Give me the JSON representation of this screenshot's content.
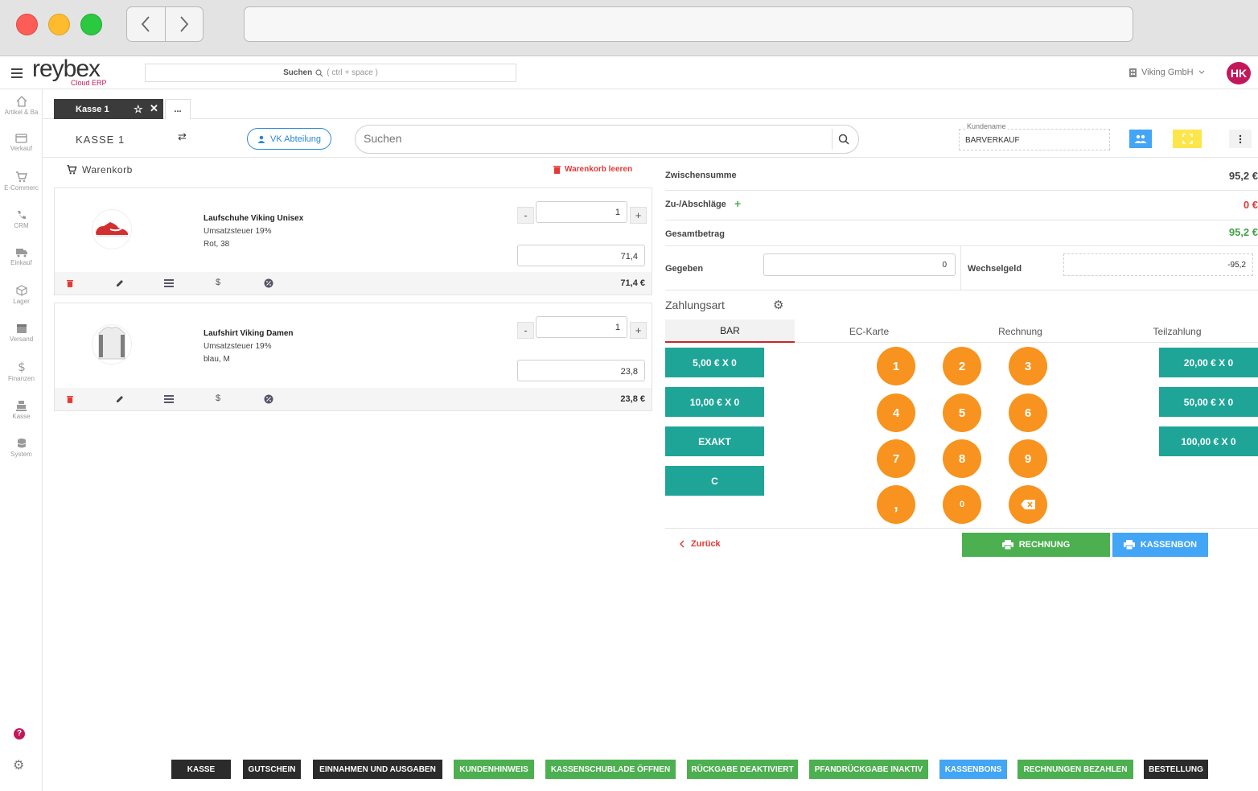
{
  "browser": {
    "url": ""
  },
  "app": {
    "logo_text": "reybex",
    "logo_sub": "Cloud ERP",
    "search_label": "Suchen",
    "search_hint": "( ctrl + space )",
    "company": "Viking GmbH",
    "avatar": "HK"
  },
  "sidebar": [
    {
      "label": "Artikel & Ba",
      "icon": "home-icon"
    },
    {
      "label": "Verkauf",
      "icon": "card-icon"
    },
    {
      "label": "E-Commerc",
      "icon": "cart-icon"
    },
    {
      "label": "CRM",
      "icon": "phone-icon"
    },
    {
      "label": "Einkauf",
      "icon": "truck-icon"
    },
    {
      "label": "Lager",
      "icon": "box-icon"
    },
    {
      "label": "Versand",
      "icon": "package-icon"
    },
    {
      "label": "Finanzen",
      "icon": "dollar-icon"
    },
    {
      "label": "Kasse",
      "icon": "register-icon"
    },
    {
      "label": "System",
      "icon": "database-icon"
    }
  ],
  "tabs": {
    "active": "Kasse 1",
    "more": "..."
  },
  "header": {
    "title": "KASSE 1",
    "department": "VK Abteilung",
    "search_placeholder": "Suchen",
    "kunde_label": "Kundename",
    "kunde_value": "BARVERKAUF"
  },
  "cart": {
    "title": "Warenkorb",
    "clear_label": "Warenkorb leeren",
    "items": [
      {
        "name": "Laufschuhe Viking Unisex",
        "tax": "Umsatzsteuer 19%",
        "variant": "Rot, 38",
        "qty": "1",
        "price": "71,4",
        "total": "71,4 €"
      },
      {
        "name": "Laufshirt Viking Damen",
        "tax": "Umsatzsteuer 19%",
        "variant": "blau, M",
        "qty": "1",
        "price": "23,8",
        "total": "23,8 €"
      }
    ]
  },
  "summary": {
    "subtotal_label": "Zwischensumme",
    "subtotal": "95,2 €",
    "surcharge_label": "Zu-/Abschläge",
    "surcharge": "0 €",
    "total_label": "Gesamtbetrag",
    "total": "95,2 €",
    "given_label": "Gegeben",
    "given": "0",
    "change_label": "Wechselgeld",
    "change": "-95,2"
  },
  "payment": {
    "title": "Zahlungsart",
    "tabs": [
      "BAR",
      "EC-Karte",
      "Rechnung",
      "Teilzahlung"
    ],
    "left_buttons": [
      "5,00 € X 0",
      "10,00 € X 0",
      "EXAKT",
      "C"
    ],
    "right_buttons": [
      "20,00 € X 0",
      "50,00 € X 0",
      "100,00 € X 0"
    ],
    "keys": [
      "1",
      "2",
      "3",
      "4",
      "5",
      "6",
      "7",
      "8",
      "9",
      ",",
      "0"
    ],
    "back_label": "Zurück",
    "invoice_label": "RECHNUNG",
    "receipt_label": "KASSENBON"
  },
  "bottom_buttons": [
    {
      "label": "KASSE",
      "color": "#2b2b2b"
    },
    {
      "label": "GUTSCHEIN",
      "color": "#2b2b2b"
    },
    {
      "label": "EINNAHMEN UND AUSGABEN",
      "color": "#2b2b2b"
    },
    {
      "label": "KUNDENHINWEIS",
      "color": "#4caf50"
    },
    {
      "label": "KASSENSCHUBLADE ÖFFNEN",
      "color": "#4caf50"
    },
    {
      "label": "RÜCKGABE DEAKTIVIERT",
      "color": "#4caf50"
    },
    {
      "label": "PFANDRÜCKGABE INAKTIV",
      "color": "#4caf50"
    },
    {
      "label": "KASSENBONS",
      "color": "#42a5f5"
    },
    {
      "label": "RECHNUNGEN BEZAHLEN",
      "color": "#4caf50"
    },
    {
      "label": "BESTELLUNG",
      "color": "#2b2b2b"
    }
  ],
  "colors": {
    "accent_teal": "#1ea597",
    "orange": "#f7931e",
    "green": "#4caf50",
    "blue": "#42a5f5",
    "red": "#e53935",
    "brand": "#c2185b"
  }
}
